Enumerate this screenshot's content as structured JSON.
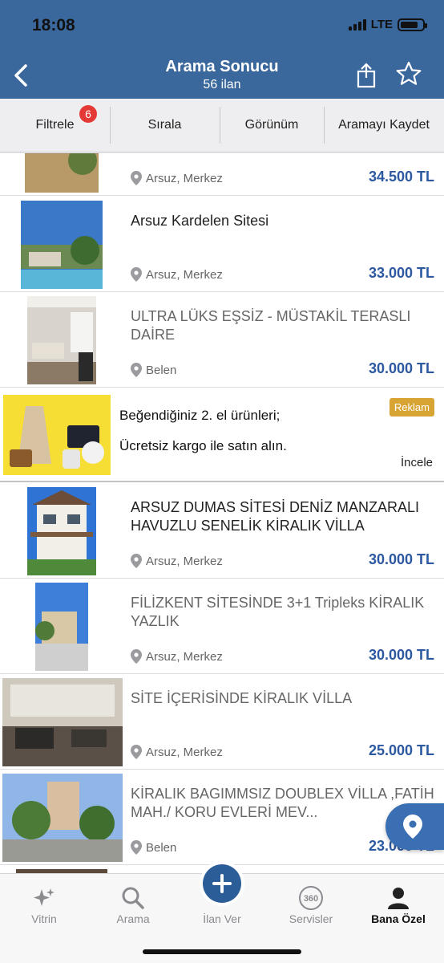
{
  "status": {
    "time": "18:08",
    "network": "LTE"
  },
  "header": {
    "title": "Arama Sonucu",
    "subtitle": "56 ilan"
  },
  "toolbar": {
    "filter_label": "Filtrele",
    "filter_badge": "6",
    "sort_label": "Sırala",
    "view_label": "Görünüm",
    "save_search_label": "Aramayı Kaydet"
  },
  "listings": [
    {
      "title": "",
      "location": "Arsuz, Merkez",
      "price": "34.500 TL"
    },
    {
      "title": "Arsuz Kardelen Sitesi",
      "location": "Arsuz, Merkez",
      "price": "33.000 TL"
    },
    {
      "title": "ULTRA LÜKS EŞSİZ - MÜSTAKİL TERASLI DAİRE",
      "location": "Belen",
      "price": "30.000 TL"
    },
    {
      "title": "ARSUZ DUMAS SİTESİ DENİZ MANZARALI HAVUZLU SENELİK KİRALIK VİLLA",
      "location": "Arsuz, Merkez",
      "price": "30.000 TL"
    },
    {
      "title": "FİLİZKENT SİTESİNDE 3+1 Tripleks KİRALIK YAZLIK",
      "location": "Arsuz, Merkez",
      "price": "30.000 TL"
    },
    {
      "title": "SİTE İÇERİSİNDE KİRALIK VİLLA",
      "location": "Arsuz, Merkez",
      "price": "25.000 TL"
    },
    {
      "title": "KİRALIK BAGIMMSIZ DOUBLEX VİLLA ,FATİH MAH./ KORU EVLERİ MEV...",
      "location": "Belen",
      "price": "23.000 TL"
    }
  ],
  "ad": {
    "line1": "Beğendiğiniz 2. el ürünleri;",
    "line2": "Ücretsiz kargo ile satın alın.",
    "badge": "Reklam",
    "cta": "İncele"
  },
  "tabs": {
    "vitrin": "Vitrin",
    "arama": "Arama",
    "ilan_ver": "İlan Ver",
    "servisler": "Servisler",
    "bana_ozel": "Bana Özel"
  },
  "colors": {
    "header": "#3a679c",
    "price": "#2d59a1",
    "badge": "#e53935",
    "ad_bg": "#f7de34",
    "ad_badge": "#d8a434"
  }
}
